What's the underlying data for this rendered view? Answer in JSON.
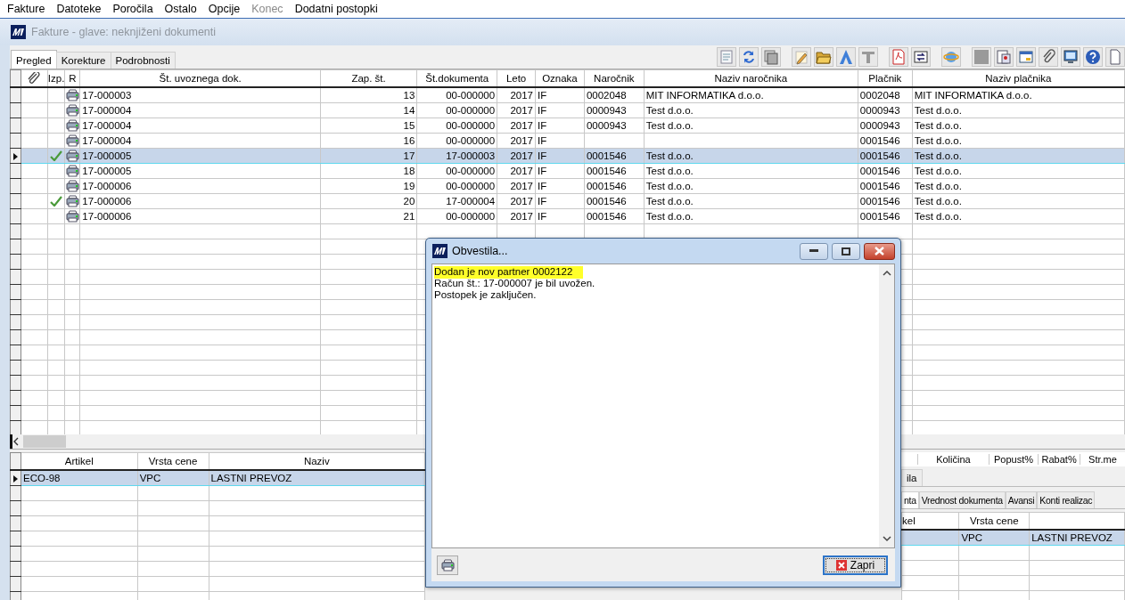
{
  "menu": [
    {
      "label": "Fakture",
      "disabled": false
    },
    {
      "label": "Datoteke",
      "disabled": false
    },
    {
      "label": "Poročila",
      "disabled": false
    },
    {
      "label": "Ostalo",
      "disabled": false
    },
    {
      "label": "Opcije",
      "disabled": false
    },
    {
      "label": "Konec",
      "disabled": true
    },
    {
      "label": "Dodatni postopki",
      "disabled": false
    }
  ],
  "window": {
    "title": "Fakture - glave: neknjiženi dokumenti"
  },
  "tabs": [
    {
      "label": "Pregled",
      "selected": true
    },
    {
      "label": "Korekture",
      "selected": false
    },
    {
      "label": "Podrobnosti",
      "selected": false
    }
  ],
  "table": {
    "columns": [
      "",
      "Izp.",
      "R",
      "Št. uvoznega dok.",
      "Zap. št.",
      "Št.dokumenta",
      "Leto",
      "Oznaka",
      "Naročnik",
      "Naziv naročnika",
      "Plačnik",
      "Naziv plačnika"
    ],
    "rows": [
      {
        "selected": false,
        "checked": false,
        "cells": [
          "",
          "",
          "",
          "17-000003",
          "13",
          "00-000000",
          "2017",
          "IF",
          "0002048",
          "MIT INFORMATIKA d.o.o.",
          "0002048",
          "MIT INFORMATIKA d.o.o."
        ]
      },
      {
        "selected": false,
        "checked": false,
        "cells": [
          "",
          "",
          "",
          "17-000004",
          "14",
          "00-000000",
          "2017",
          "IF",
          "0000943",
          "Test d.o.o.",
          "0000943",
          "Test d.o.o."
        ]
      },
      {
        "selected": false,
        "checked": false,
        "cells": [
          "",
          "",
          "",
          "17-000004",
          "15",
          "00-000000",
          "2017",
          "IF",
          "0000943",
          "Test d.o.o.",
          "0000943",
          "Test d.o.o."
        ]
      },
      {
        "selected": false,
        "checked": false,
        "cells": [
          "",
          "",
          "",
          "17-000004",
          "16",
          "00-000000",
          "2017",
          "IF",
          "",
          "",
          "0001546",
          "Test d.o.o."
        ]
      },
      {
        "selected": true,
        "checked": true,
        "cells": [
          "",
          "",
          "",
          "17-000005",
          "17",
          "17-000003",
          "2017",
          "IF",
          "0001546",
          "Test d.o.o.",
          "0001546",
          "Test d.o.o."
        ]
      },
      {
        "selected": false,
        "checked": false,
        "cells": [
          "",
          "",
          "",
          "17-000005",
          "18",
          "00-000000",
          "2017",
          "IF",
          "0001546",
          "Test d.o.o.",
          "0001546",
          "Test d.o.o."
        ]
      },
      {
        "selected": false,
        "checked": false,
        "cells": [
          "",
          "",
          "",
          "17-000006",
          "19",
          "00-000000",
          "2017",
          "IF",
          "0001546",
          "Test d.o.o.",
          "0001546",
          "Test d.o.o."
        ]
      },
      {
        "selected": false,
        "checked": true,
        "cells": [
          "",
          "",
          "",
          "17-000006",
          "20",
          "17-000004",
          "2017",
          "IF",
          "0001546",
          "Test d.o.o.",
          "0001546",
          "Test d.o.o."
        ]
      },
      {
        "selected": false,
        "checked": false,
        "cells": [
          "",
          "",
          "",
          "17-000006",
          "21",
          "00-000000",
          "2017",
          "IF",
          "0001546",
          "Test d.o.o.",
          "0001546",
          "Test d.o.o."
        ]
      }
    ]
  },
  "items_table": {
    "columns": [
      "Artikel",
      "Vrsta cene",
      "Naziv"
    ],
    "rows": [
      {
        "selected": true,
        "cells": [
          "ECO-98",
          "VPC",
          "LASTNI PREVOZ"
        ]
      }
    ]
  },
  "right_panel": {
    "columns": [
      "Količina",
      "Popust%",
      "Rabat%",
      "Str.me"
    ],
    "upper_tabs": [
      {
        "label": "ila",
        "selected": false
      }
    ],
    "tabs": [
      {
        "label": "nta",
        "selected": true
      },
      {
        "label": "Vrednost dokumenta",
        "selected": false
      },
      {
        "label": "Avansi",
        "selected": false
      },
      {
        "label": "Konti realizac",
        "selected": false
      }
    ],
    "table": {
      "columns": [
        "kel",
        "Vrsta cene",
        ""
      ],
      "rows": [
        {
          "selected": true,
          "cells": [
            "",
            "VPC",
            "LASTNI PREVOZ"
          ]
        }
      ]
    }
  },
  "dialog": {
    "title": "Obvestila...",
    "lines": [
      {
        "text": "Dodan je nov partner 0002122",
        "highlighted": true
      },
      {
        "text": "Račun št.: 17-000007 je bil uvožen.",
        "highlighted": false
      },
      {
        "text": "Postopek je zaključen.",
        "highlighted": false
      }
    ],
    "close_button": "Zapri"
  }
}
